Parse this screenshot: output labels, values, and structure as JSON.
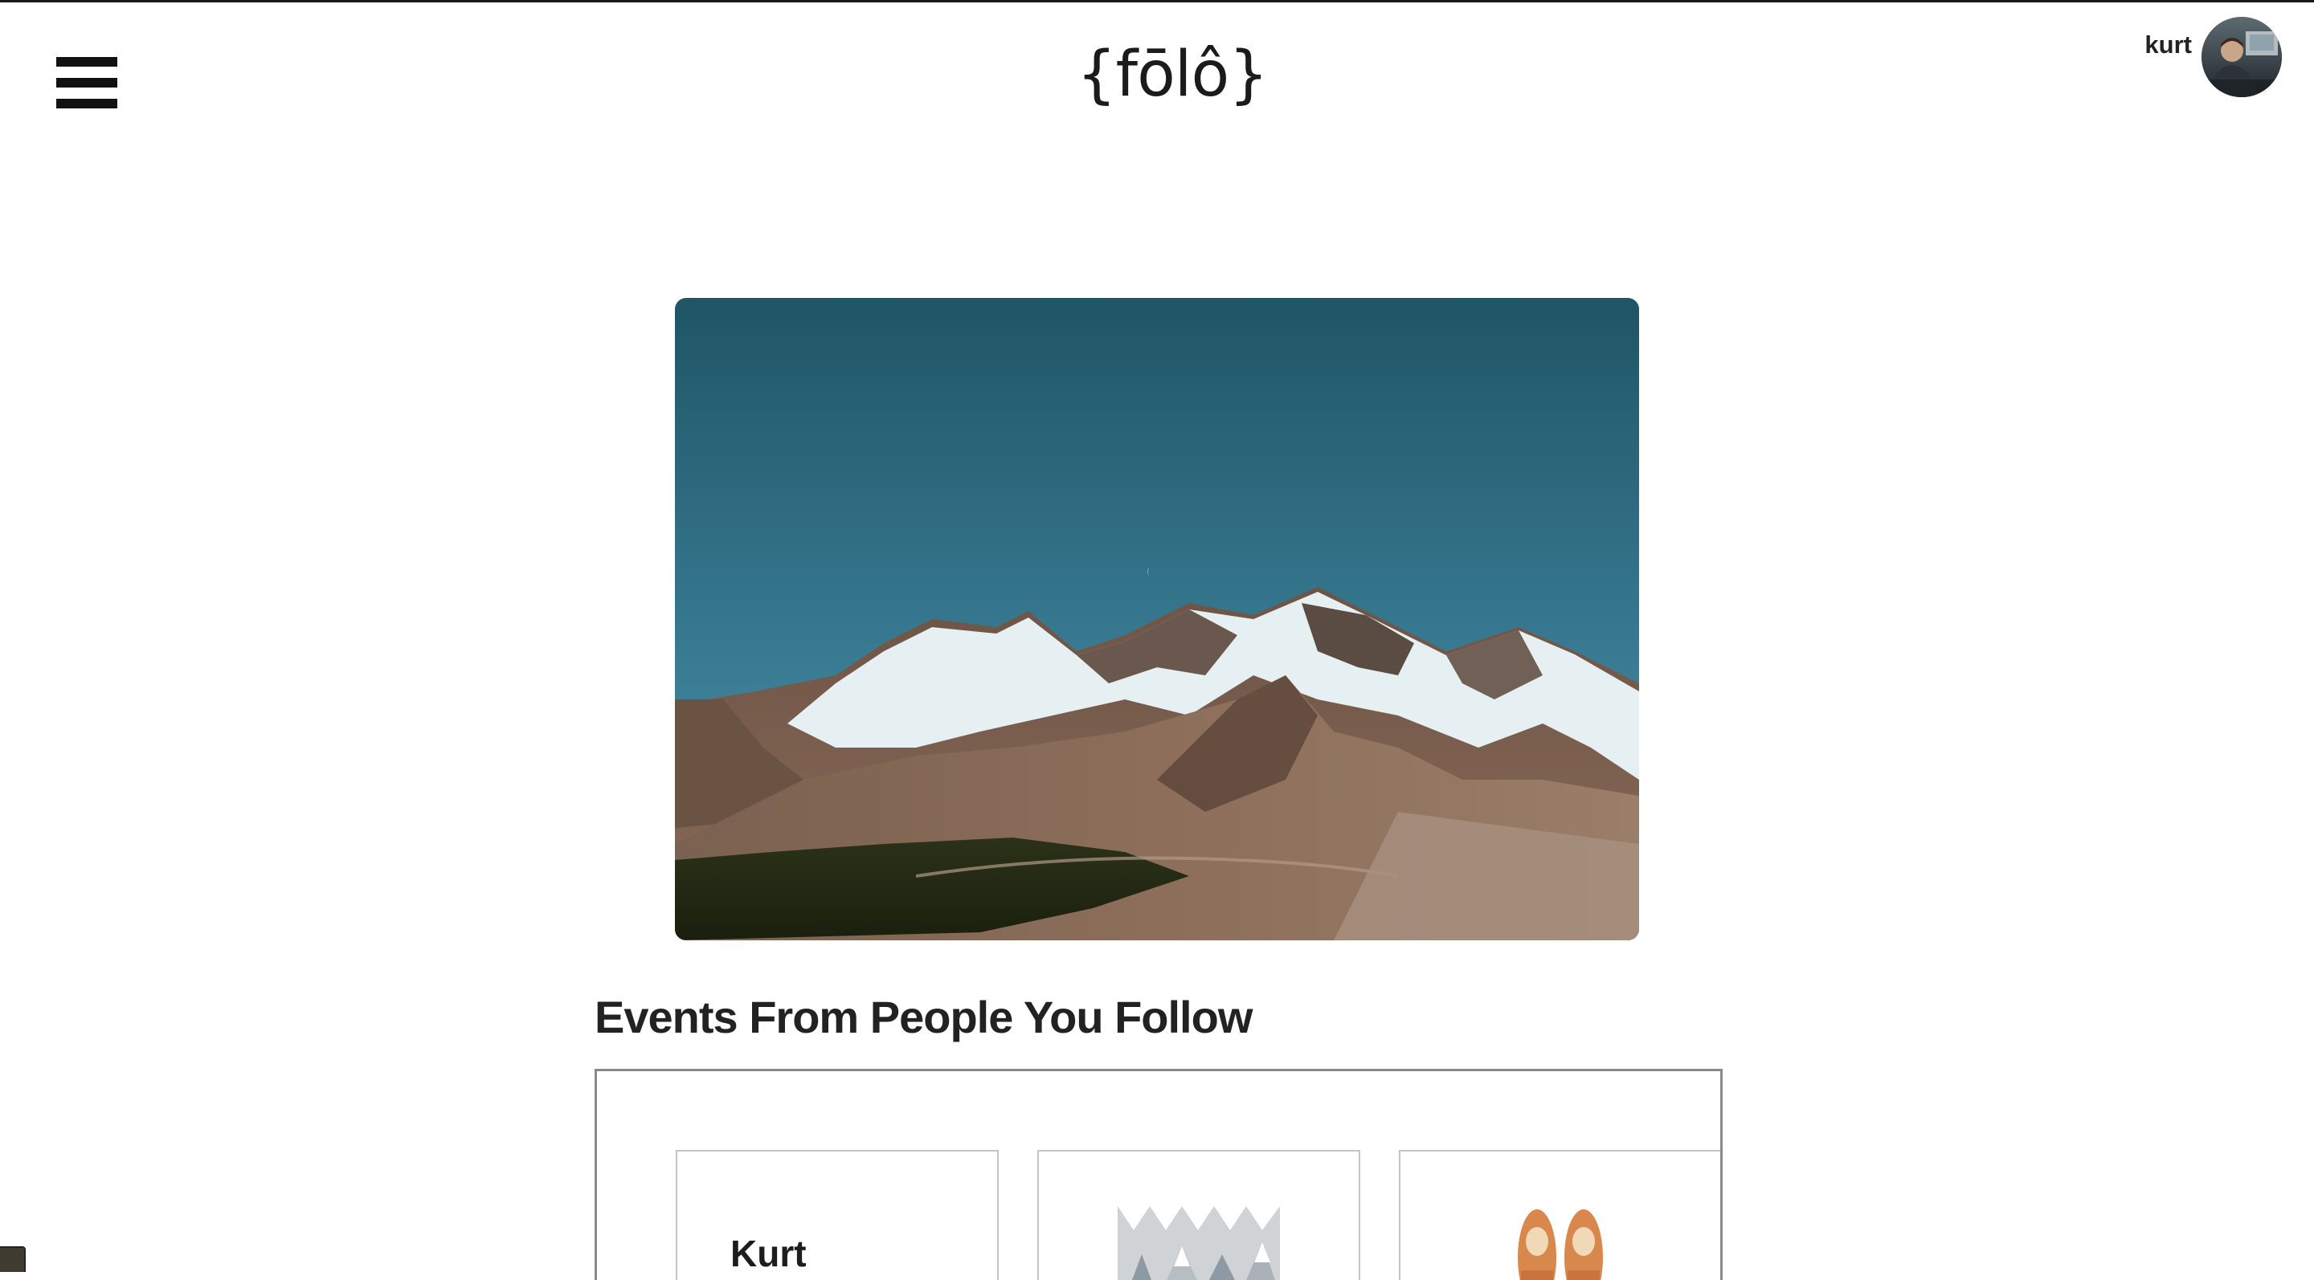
{
  "header": {
    "logo": "{fōlô}",
    "username": "kurt",
    "menu_icon": "hamburger-menu-icon",
    "avatar_icon": "user-avatar-photo"
  },
  "hero": {
    "image": "snowy-mountain-range-photo"
  },
  "events": {
    "title": "Events From People You Follow",
    "cards": [
      {
        "label": "Kurt",
        "image": ""
      },
      {
        "label": "",
        "image": "geometric-mountains-illustration"
      },
      {
        "label": "",
        "image": "orange-sneakers-photo"
      }
    ]
  },
  "colors": {
    "sky_top": "#1f5566",
    "sky_bottom": "#4a8fa8",
    "text": "#222222",
    "panel_border": "#8a8a8a"
  }
}
